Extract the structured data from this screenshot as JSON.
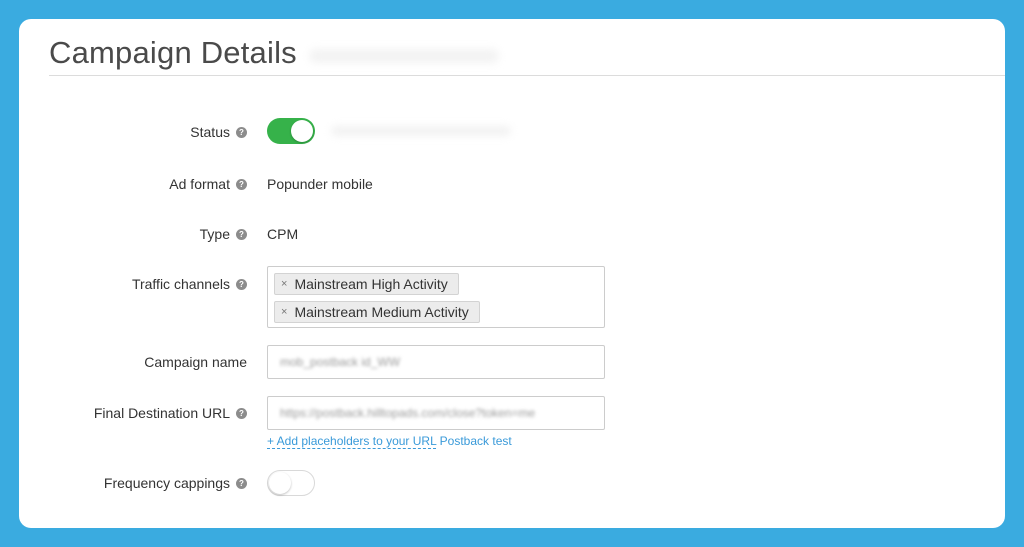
{
  "header": {
    "title": "Campaign Details"
  },
  "help_glyph": "?",
  "fields": {
    "status": {
      "label": "Status",
      "enabled": true
    },
    "ad_format": {
      "label": "Ad format",
      "value": "Popunder mobile"
    },
    "type": {
      "label": "Type",
      "value": "CPM"
    },
    "traffic_channels": {
      "label": "Traffic channels",
      "remove_glyph": "×",
      "tags": [
        "Mainstream High Activity",
        "Mainstream Medium Activity"
      ]
    },
    "campaign_name": {
      "label": "Campaign name",
      "value": "mob_postback id_WW"
    },
    "final_destination_url": {
      "label": "Final Destination URL",
      "value": "https://postback.hilltopads.com/close?token=me",
      "add_placeholders_link": "+ Add placeholders to your URL",
      "postback_test_link": "Postback test"
    },
    "frequency_cappings": {
      "label": "Frequency cappings",
      "enabled": false
    }
  },
  "colors": {
    "background": "#3aabe0",
    "toggle_on": "#36b24a",
    "link": "#3a9ad9"
  }
}
